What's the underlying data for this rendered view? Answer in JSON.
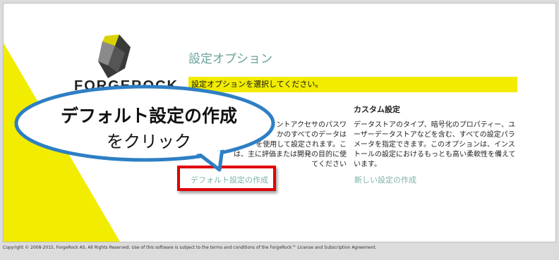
{
  "page": {
    "title": "設定オプション",
    "banner": "設定オプションを選択してください。",
    "brand": "FORGEROCK"
  },
  "default_config": {
    "description_visible": "ントアクセサのパスワ｜かのすべてのデータは｜を使用して設定されます。こ｜は、主に評価または開発の目的に使｜てください",
    "link": "デフォルト設定の作成"
  },
  "custom_config": {
    "heading": "カスタム設定",
    "description": "データストアのタイプ、暗号化のプロパティー、ユーザーデータストアなどを含む、すべての設定パラメータを指定できます。このオプションは、インストールの設定におけるもっとも高い柔軟性を備えています。",
    "link": "新しい設定の作成"
  },
  "callout": {
    "line1": "デフォルト設定の作成",
    "line2": "をクリック"
  },
  "footer": {
    "copyright": "Copyright © 2008-2015, ForgeRock AS. All Rights Reserved. Use of this software is subject to the terms and conditions of the ForgeRock™ License and Subscription Agreement."
  },
  "colors": {
    "accent_yellow": "#f1ec00",
    "link_teal": "#7db3a8",
    "title_teal": "#6aa39a",
    "callout_blue": "#2e7fc4",
    "highlight_red": "#e00000"
  }
}
